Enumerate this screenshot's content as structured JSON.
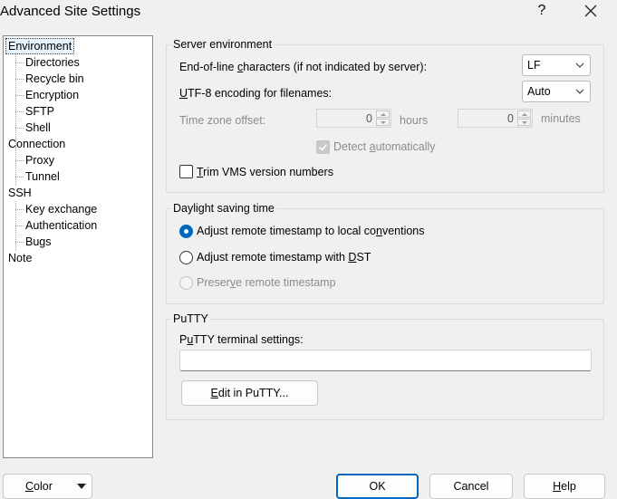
{
  "window": {
    "title": "Advanced Site Settings",
    "help_glyph": "?",
    "close_glyph": "✕"
  },
  "tree": {
    "items": [
      {
        "label": "Environment",
        "level": 0,
        "selected": true
      },
      {
        "label": "Directories",
        "level": 1
      },
      {
        "label": "Recycle bin",
        "level": 1
      },
      {
        "label": "Encryption",
        "level": 1
      },
      {
        "label": "SFTP",
        "level": 1
      },
      {
        "label": "Shell",
        "level": 1
      },
      {
        "label": "Connection",
        "level": 0
      },
      {
        "label": "Proxy",
        "level": 1
      },
      {
        "label": "Tunnel",
        "level": 1
      },
      {
        "label": "SSH",
        "level": 0
      },
      {
        "label": "Key exchange",
        "level": 1
      },
      {
        "label": "Authentication",
        "level": 1
      },
      {
        "label": "Bugs",
        "level": 1
      },
      {
        "label": "Note",
        "level": 0
      }
    ]
  },
  "server_env": {
    "title": "Server environment",
    "eol_label_pre": "End-of-line ",
    "eol_label_u": "c",
    "eol_label_post": "haracters (if not indicated by server):",
    "eol_value": "LF",
    "utf8_label_u": "U",
    "utf8_label_post": "TF-8 encoding for filenames:",
    "utf8_value": "Auto",
    "tz_label": "Time zone offset:",
    "hours_value": "0",
    "hours_label": "hours",
    "minutes_value": "0",
    "minutes_label": "minutes",
    "detect_pre": "Detect ",
    "detect_u": "a",
    "detect_post": "utomatically",
    "detect_checked": true,
    "trim_u": "T",
    "trim_post": "rim VMS version numbers",
    "trim_checked": false
  },
  "dst": {
    "title": "Daylight saving time",
    "opt1_pre": "Adjust remote timestamp to local co",
    "opt1_u": "n",
    "opt1_post": "ventions",
    "opt2_pre": "Adjust remote timestamp with ",
    "opt2_u": "D",
    "opt2_post": "ST",
    "opt3_pre": "Preser",
    "opt3_u": "v",
    "opt3_post": "e remote timestamp",
    "selected": 1
  },
  "putty": {
    "title": "PuTTY",
    "settings_pre": "P",
    "settings_u": "u",
    "settings_post": "TTY terminal settings:",
    "settings_value": "",
    "edit_u": "E",
    "edit_post": "dit in PuTTY..."
  },
  "footer": {
    "color_u": "C",
    "color_post": "olor",
    "ok_label": "OK",
    "cancel_label": "Cancel",
    "help_u": "H",
    "help_post": "elp"
  },
  "colors": {
    "accent": "#0067c0",
    "window_bg": "#f0f0f0",
    "disabled_text": "#8c8c8c"
  }
}
